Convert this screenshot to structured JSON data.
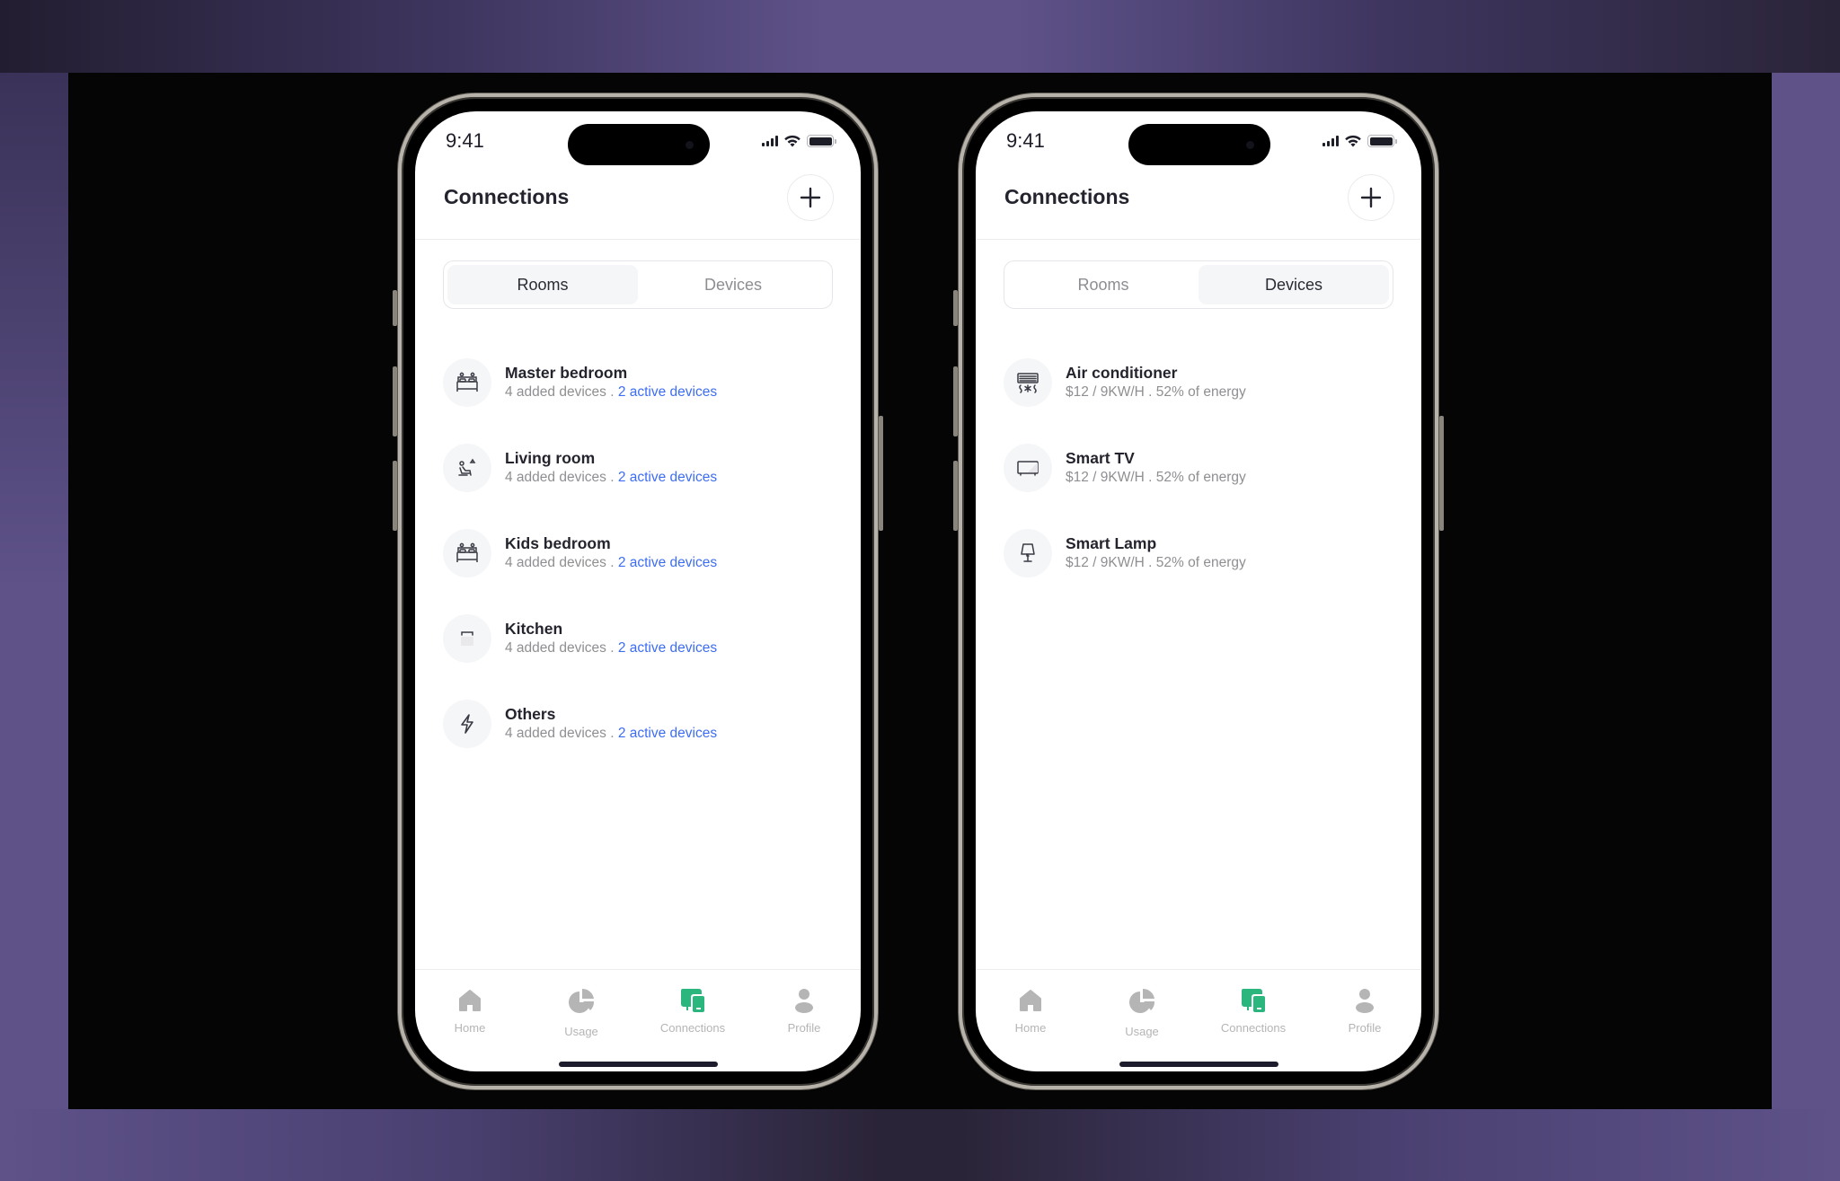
{
  "colors": {
    "accent_green": "#2bb67e",
    "link_blue": "#3d6df2",
    "text_dark": "#24242e",
    "text_muted": "#8f8f93",
    "tab_inactive": "#b5b5b5"
  },
  "phones": [
    {
      "status": {
        "time": "9:41"
      },
      "header": {
        "title": "Connections",
        "add_icon": "plus-icon"
      },
      "segment": {
        "options": [
          "Rooms",
          "Devices"
        ],
        "selected": "Rooms"
      },
      "items": [
        {
          "icon": "bed-icon",
          "title": "Master bedroom",
          "sub_prefix": "4 added devices . ",
          "sub_link": "2 active devices"
        },
        {
          "icon": "sofa-person-icon",
          "title": "Living room",
          "sub_prefix": "4 added devices . ",
          "sub_link": "2 active devices"
        },
        {
          "icon": "bed-icon",
          "title": "Kids bedroom",
          "sub_prefix": "4 added devices . ",
          "sub_link": "2 active devices"
        },
        {
          "icon": "toaster-icon",
          "title": "Kitchen",
          "sub_prefix": "4 added devices . ",
          "sub_link": "2 active devices"
        },
        {
          "icon": "lightning-icon",
          "title": "Others",
          "sub_prefix": "4 added devices . ",
          "sub_link": "2 active devices"
        }
      ],
      "tabbar": [
        {
          "icon": "home-icon",
          "label": "Home",
          "active": false
        },
        {
          "icon": "pie-chart-icon",
          "label": "Usage",
          "active": false
        },
        {
          "icon": "devices-icon",
          "label": "Connections",
          "active": true
        },
        {
          "icon": "user-icon",
          "label": "Profile",
          "active": false
        }
      ]
    },
    {
      "status": {
        "time": "9:41"
      },
      "header": {
        "title": "Connections",
        "add_icon": "plus-icon"
      },
      "segment": {
        "options": [
          "Rooms",
          "Devices"
        ],
        "selected": "Devices"
      },
      "items": [
        {
          "icon": "air-conditioner-icon",
          "title": "Air conditioner",
          "sub_prefix": "$12 / 9KW/H . 52% of energy",
          "sub_link": ""
        },
        {
          "icon": "tv-icon",
          "title": "Smart TV",
          "sub_prefix": "$12 / 9KW/H . 52% of energy",
          "sub_link": ""
        },
        {
          "icon": "lamp-icon",
          "title": "Smart Lamp",
          "sub_prefix": "$12 / 9KW/H . 52% of energy",
          "sub_link": ""
        }
      ],
      "tabbar": [
        {
          "icon": "home-icon",
          "label": "Home",
          "active": false
        },
        {
          "icon": "pie-chart-icon",
          "label": "Usage",
          "active": false
        },
        {
          "icon": "devices-icon",
          "label": "Connections",
          "active": true
        },
        {
          "icon": "user-icon",
          "label": "Profile",
          "active": false
        }
      ]
    }
  ]
}
